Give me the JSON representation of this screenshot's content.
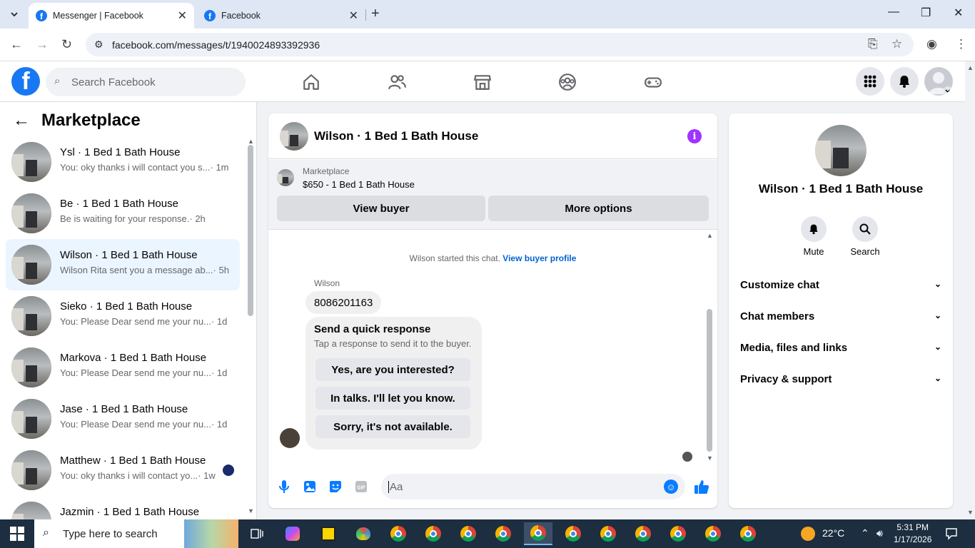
{
  "browser": {
    "tabs": [
      {
        "title": "Messenger | Facebook",
        "active": true
      },
      {
        "title": "Facebook",
        "active": false
      }
    ],
    "url": "facebook.com/messages/t/1940024893392936"
  },
  "header": {
    "search_placeholder": "Search Facebook",
    "nav_icons": [
      "home-icon",
      "friends-icon",
      "marketplace-icon",
      "groups-icon",
      "gaming-icon"
    ],
    "right_icons": [
      "menu-grid-icon",
      "notifications-bell-icon",
      "account-avatar"
    ]
  },
  "sidebar": {
    "title": "Marketplace",
    "conversations": [
      {
        "name": "Ysl · 1 Bed 1 Bath House",
        "preview": "You: oky thanks i will contact you s...",
        "time": "· 1m"
      },
      {
        "name": "Be · 1 Bed 1 Bath House",
        "preview": "Be is waiting for your response.",
        "time": "· 2h"
      },
      {
        "name": "Wilson · 1 Bed 1 Bath House",
        "preview": "Wilson Rita sent you a message ab...",
        "time": "· 5h"
      },
      {
        "name": "Sieko · 1 Bed 1 Bath House",
        "preview": "You: Please Dear send me your nu...",
        "time": "· 1d"
      },
      {
        "name": "Markova · 1 Bed 1 Bath House",
        "preview": "You: Please Dear send me your nu...",
        "time": "· 1d"
      },
      {
        "name": "Jase · 1 Bed 1 Bath House",
        "preview": "You: Please Dear send me your nu...",
        "time": "· 1d"
      },
      {
        "name": "Matthew · 1 Bed 1 Bath House",
        "preview": "You: oky thanks i will contact yo...",
        "time": "· 1w"
      },
      {
        "name": "Jazmin · 1 Bed 1 Bath House",
        "preview": "",
        "time": ""
      }
    ]
  },
  "chat": {
    "title": "Wilson · 1 Bed 1 Bath House",
    "marketplace_label": "Marketplace",
    "listing": "$650 - 1 Bed 1 Bath House",
    "view_buyer": "View buyer",
    "more_options": "More options",
    "system_text": "Wilson started this chat.",
    "system_link": "View buyer profile",
    "sender": "Wilson",
    "message": "8086201163",
    "quick_title": "Send a quick response",
    "quick_sub": "Tap a response to send it to the buyer.",
    "quick_replies": [
      "Yes, are you interested?",
      "In talks. I'll let you know.",
      "Sorry, it's not available."
    ],
    "composer_placeholder": "Aa"
  },
  "details": {
    "name": "Wilson · 1 Bed 1 Bath House",
    "mute": "Mute",
    "search": "Search",
    "sections": [
      "Customize chat",
      "Chat members",
      "Media, files and links",
      "Privacy & support"
    ]
  },
  "taskbar": {
    "search_placeholder": "Type here to search",
    "temperature": "22°C",
    "time": "5:31 PM",
    "date": "1/17/2026"
  },
  "colors": {
    "fb_blue": "#1877f2",
    "messenger_blue": "#0a7cff",
    "info_purple": "#a033ff"
  }
}
